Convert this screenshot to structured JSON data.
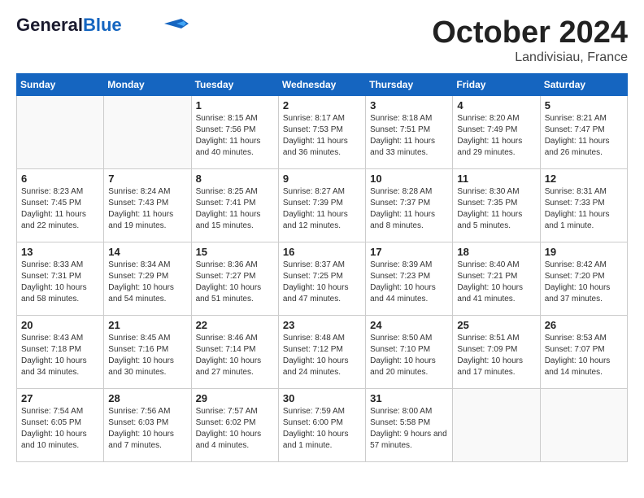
{
  "logo": {
    "text_general": "General",
    "text_blue": "Blue"
  },
  "header": {
    "month": "October 2024",
    "location": "Landivisiau, France"
  },
  "weekdays": [
    "Sunday",
    "Monday",
    "Tuesday",
    "Wednesday",
    "Thursday",
    "Friday",
    "Saturday"
  ],
  "weeks": [
    [
      {
        "day": "",
        "info": ""
      },
      {
        "day": "",
        "info": ""
      },
      {
        "day": "1",
        "info": "Sunrise: 8:15 AM\nSunset: 7:56 PM\nDaylight: 11 hours and 40 minutes."
      },
      {
        "day": "2",
        "info": "Sunrise: 8:17 AM\nSunset: 7:53 PM\nDaylight: 11 hours and 36 minutes."
      },
      {
        "day": "3",
        "info": "Sunrise: 8:18 AM\nSunset: 7:51 PM\nDaylight: 11 hours and 33 minutes."
      },
      {
        "day": "4",
        "info": "Sunrise: 8:20 AM\nSunset: 7:49 PM\nDaylight: 11 hours and 29 minutes."
      },
      {
        "day": "5",
        "info": "Sunrise: 8:21 AM\nSunset: 7:47 PM\nDaylight: 11 hours and 26 minutes."
      }
    ],
    [
      {
        "day": "6",
        "info": "Sunrise: 8:23 AM\nSunset: 7:45 PM\nDaylight: 11 hours and 22 minutes."
      },
      {
        "day": "7",
        "info": "Sunrise: 8:24 AM\nSunset: 7:43 PM\nDaylight: 11 hours and 19 minutes."
      },
      {
        "day": "8",
        "info": "Sunrise: 8:25 AM\nSunset: 7:41 PM\nDaylight: 11 hours and 15 minutes."
      },
      {
        "day": "9",
        "info": "Sunrise: 8:27 AM\nSunset: 7:39 PM\nDaylight: 11 hours and 12 minutes."
      },
      {
        "day": "10",
        "info": "Sunrise: 8:28 AM\nSunset: 7:37 PM\nDaylight: 11 hours and 8 minutes."
      },
      {
        "day": "11",
        "info": "Sunrise: 8:30 AM\nSunset: 7:35 PM\nDaylight: 11 hours and 5 minutes."
      },
      {
        "day": "12",
        "info": "Sunrise: 8:31 AM\nSunset: 7:33 PM\nDaylight: 11 hours and 1 minute."
      }
    ],
    [
      {
        "day": "13",
        "info": "Sunrise: 8:33 AM\nSunset: 7:31 PM\nDaylight: 10 hours and 58 minutes."
      },
      {
        "day": "14",
        "info": "Sunrise: 8:34 AM\nSunset: 7:29 PM\nDaylight: 10 hours and 54 minutes."
      },
      {
        "day": "15",
        "info": "Sunrise: 8:36 AM\nSunset: 7:27 PM\nDaylight: 10 hours and 51 minutes."
      },
      {
        "day": "16",
        "info": "Sunrise: 8:37 AM\nSunset: 7:25 PM\nDaylight: 10 hours and 47 minutes."
      },
      {
        "day": "17",
        "info": "Sunrise: 8:39 AM\nSunset: 7:23 PM\nDaylight: 10 hours and 44 minutes."
      },
      {
        "day": "18",
        "info": "Sunrise: 8:40 AM\nSunset: 7:21 PM\nDaylight: 10 hours and 41 minutes."
      },
      {
        "day": "19",
        "info": "Sunrise: 8:42 AM\nSunset: 7:20 PM\nDaylight: 10 hours and 37 minutes."
      }
    ],
    [
      {
        "day": "20",
        "info": "Sunrise: 8:43 AM\nSunset: 7:18 PM\nDaylight: 10 hours and 34 minutes."
      },
      {
        "day": "21",
        "info": "Sunrise: 8:45 AM\nSunset: 7:16 PM\nDaylight: 10 hours and 30 minutes."
      },
      {
        "day": "22",
        "info": "Sunrise: 8:46 AM\nSunset: 7:14 PM\nDaylight: 10 hours and 27 minutes."
      },
      {
        "day": "23",
        "info": "Sunrise: 8:48 AM\nSunset: 7:12 PM\nDaylight: 10 hours and 24 minutes."
      },
      {
        "day": "24",
        "info": "Sunrise: 8:50 AM\nSunset: 7:10 PM\nDaylight: 10 hours and 20 minutes."
      },
      {
        "day": "25",
        "info": "Sunrise: 8:51 AM\nSunset: 7:09 PM\nDaylight: 10 hours and 17 minutes."
      },
      {
        "day": "26",
        "info": "Sunrise: 8:53 AM\nSunset: 7:07 PM\nDaylight: 10 hours and 14 minutes."
      }
    ],
    [
      {
        "day": "27",
        "info": "Sunrise: 7:54 AM\nSunset: 6:05 PM\nDaylight: 10 hours and 10 minutes."
      },
      {
        "day": "28",
        "info": "Sunrise: 7:56 AM\nSunset: 6:03 PM\nDaylight: 10 hours and 7 minutes."
      },
      {
        "day": "29",
        "info": "Sunrise: 7:57 AM\nSunset: 6:02 PM\nDaylight: 10 hours and 4 minutes."
      },
      {
        "day": "30",
        "info": "Sunrise: 7:59 AM\nSunset: 6:00 PM\nDaylight: 10 hours and 1 minute."
      },
      {
        "day": "31",
        "info": "Sunrise: 8:00 AM\nSunset: 5:58 PM\nDaylight: 9 hours and 57 minutes."
      },
      {
        "day": "",
        "info": ""
      },
      {
        "day": "",
        "info": ""
      }
    ]
  ]
}
